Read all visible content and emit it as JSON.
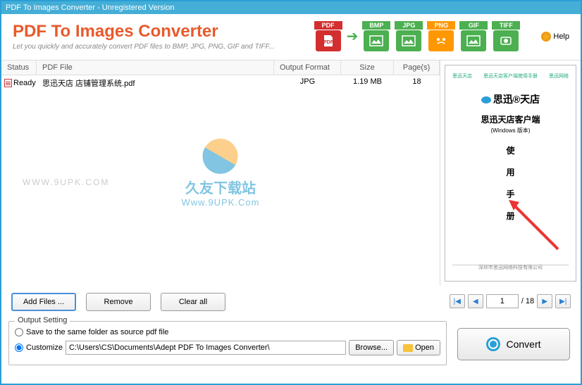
{
  "titlebar": "PDF To Images Converter - Unregistered Version",
  "app": {
    "title": "PDF To Images Converter",
    "subtitle": "Let you quickly and accurately convert PDF files to  BMP, JPG, PNG, GIF and TIFF..."
  },
  "formats": {
    "pdf": "PDF",
    "bmp": "BMP",
    "jpg": "JPG",
    "png": "PNG",
    "gif": "GIF",
    "tiff": "TIFF"
  },
  "help": "Help",
  "table": {
    "headers": {
      "status": "Status",
      "file": "PDF File",
      "format": "Output Format",
      "size": "Size",
      "pages": "Page(s)"
    },
    "row": {
      "status": "Ready",
      "file": "思迅天店 店铺管理系统.pdf",
      "format": "JPG",
      "size": "1.19 MB",
      "pages": "18"
    }
  },
  "watermark": {
    "side": "WWW.9UPK.COM",
    "cn": "久友下载站",
    "en": "Www.9UPK.Com"
  },
  "buttons": {
    "add": "Add Files ...",
    "remove": "Remove",
    "clear": "Clear all"
  },
  "pager": {
    "current": "1",
    "total": "/ 18"
  },
  "preview": {
    "top_l": "思迅天店",
    "top_c": "思迅天店客户端使用手册",
    "top_r": "思迅网络",
    "brand": "思迅®天店",
    "title": "思迅天店客户端",
    "sub": "(Windows 版本)",
    "c1": "使",
    "c2": "用",
    "c3": "手",
    "c4": "册",
    "foot": "深圳市思迅网络科技有限公司"
  },
  "output": {
    "legend": "Output Setting",
    "same": "Save to the same folder as source pdf file",
    "custom": "Customize",
    "path": "C:\\Users\\CS\\Documents\\Adept PDF To Images Converter\\",
    "browse": "Browse...",
    "open": "Open"
  },
  "convert": "Convert"
}
